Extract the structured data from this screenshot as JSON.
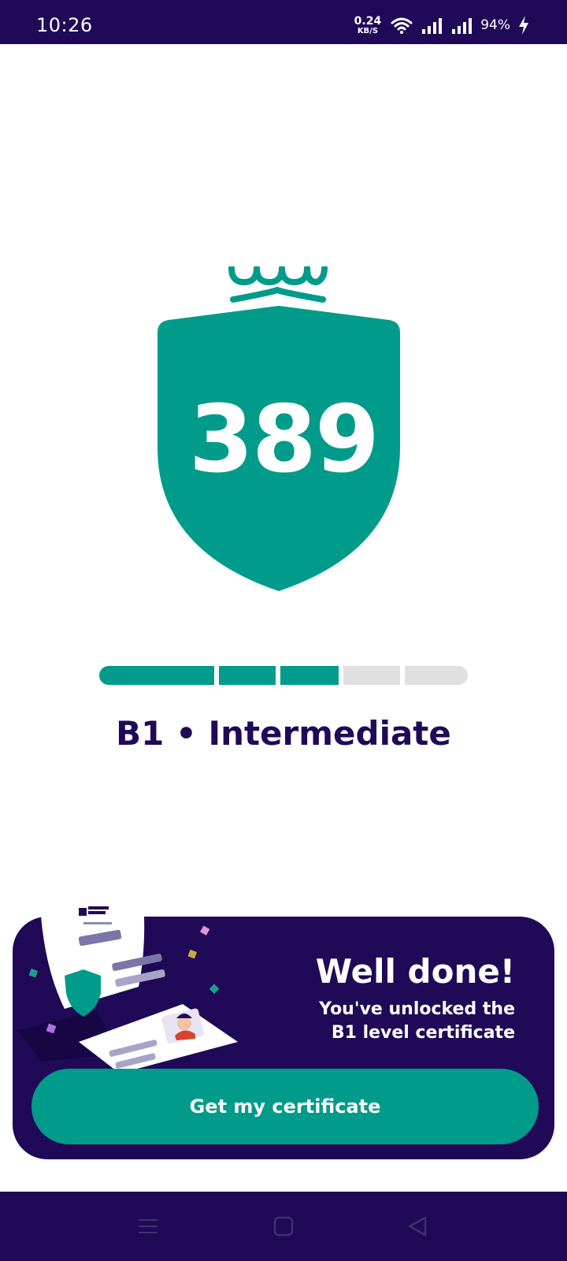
{
  "status_bar": {
    "time": "10:26",
    "net_speed_value": "0.24",
    "net_speed_unit": "KB/S",
    "battery": "94%",
    "icons": [
      "wifi-icon",
      "signal-icon",
      "signal-icon",
      "charging-icon"
    ]
  },
  "score": {
    "value": "389",
    "level_progress": 0.66
  },
  "level": {
    "text": "B1 • Intermediate"
  },
  "certificate_card": {
    "title": "Well done!",
    "subtitle_line1": "You've unlocked the",
    "subtitle_line2": "B1 level certificate",
    "button_label": "Get my certificate"
  },
  "colors": {
    "primary": "#009b8a",
    "dark": "#200a58",
    "track": "#e0e0e0"
  },
  "nav_bar": {
    "icons": [
      "menu-icon",
      "home-square-icon",
      "back-triangle-icon"
    ]
  }
}
